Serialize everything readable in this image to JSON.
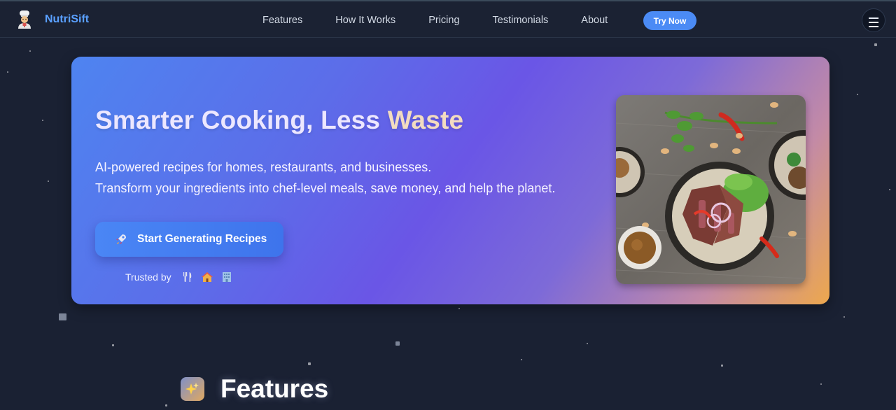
{
  "nav": {
    "brand": "NutriSift",
    "brand_icon": "chef-icon",
    "links": [
      "Features",
      "How It Works",
      "Pricing",
      "Testimonials",
      "About"
    ],
    "try_label": "Try Now",
    "menu_icon": "hamburger-menu-icon"
  },
  "hero": {
    "title_main": "Smarter Cooking, Less ",
    "title_accent": "Waste",
    "desc_line1": "AI-powered recipes for homes, restaurants, and businesses.",
    "desc_line2": "Transform your ingredients into chef-level meals, save money, and help the planet.",
    "cta_label": "Start Generating Recipes",
    "cta_icon": "rocket-icon",
    "trusted_label": "Trusted by",
    "trusted_icons": [
      "fork-knife-icon",
      "house-icon",
      "office-building-icon"
    ],
    "image": "steak-salad-bowls-photo"
  },
  "features": {
    "title": "Features",
    "icon": "sparkles-icon"
  },
  "colors": {
    "background": "#1a2133",
    "brand": "#5aa0ff",
    "button": "#4b8bf5",
    "hero_gradient_start": "#4e84f0",
    "hero_gradient_mid": "#6a56e6",
    "hero_gradient_end": "#eda84d"
  }
}
